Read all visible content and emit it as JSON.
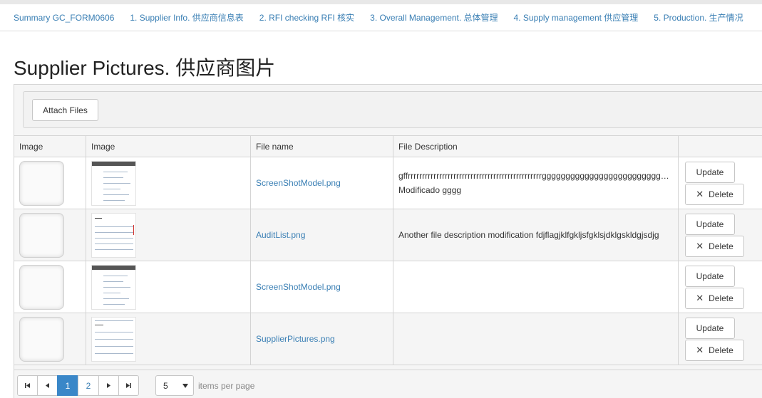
{
  "tabs": [
    "Summary GC_FORM0606",
    "1. Supplier Info. 供应商信息表",
    "2. RFI checking RFI 核实",
    "3. Overall Management. 总体管理",
    "4. Supply management 供应管理",
    "5. Production. 生产情况"
  ],
  "page_title": "Supplier Pictures. 供应商图片",
  "toolbar": {
    "attach_label": "Attach Files"
  },
  "grid": {
    "columns": [
      "Image",
      "Image",
      "File name",
      "File Description",
      ""
    ],
    "rows": [
      {
        "file_name": "ScreenShotModel.png",
        "description_line1": "gffrrrrrrrrrrrrrrrrrrrrrrrrrrrrrrrrrrrrrrrrrrrrrrrgggggggggggggggggggggggggggggggggg...",
        "description_line2": "Modificado gggg",
        "update_label": "Update",
        "delete_label": "Delete"
      },
      {
        "file_name": "AuditList.png",
        "description_line1": "Another file description modification fdjflagjklfgkljsfgklsjdklgskldgjsdjg",
        "description_line2": "",
        "update_label": "Update",
        "delete_label": "Delete"
      },
      {
        "file_name": "ScreenShotModel.png",
        "description_line1": "",
        "description_line2": "",
        "update_label": "Update",
        "delete_label": "Delete"
      },
      {
        "file_name": "SupplierPictures.png",
        "description_line1": "",
        "description_line2": "",
        "update_label": "Update",
        "delete_label": "Delete"
      }
    ]
  },
  "pager": {
    "first_icon": "first-page-icon",
    "prev_icon": "prev-page-icon",
    "next_icon": "next-page-icon",
    "last_icon": "last-page-icon",
    "pages": [
      "1",
      "2"
    ],
    "current_page": "1",
    "page_size": "5",
    "items_per_page_label": "items per page"
  },
  "colors": {
    "link": "#3a7fb4",
    "active_page": "#3a87c8"
  }
}
